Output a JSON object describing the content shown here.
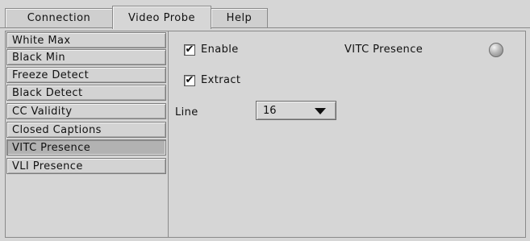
{
  "tabs": [
    {
      "label": "Connection",
      "active": false
    },
    {
      "label": "Video Probe",
      "active": true
    },
    {
      "label": "Help",
      "active": false
    }
  ],
  "sidebar": {
    "items": [
      {
        "label": "White Max"
      },
      {
        "label": "Black Min"
      },
      {
        "label": "Freeze Detect"
      },
      {
        "label": "Black Detect"
      },
      {
        "label": "CC Validity"
      },
      {
        "label": "Closed Captions"
      },
      {
        "label": "VITC Presence",
        "selected": true
      },
      {
        "label": "VLI Presence"
      }
    ]
  },
  "content": {
    "enable": {
      "label": "Enable",
      "checked": true,
      "mark": "✔"
    },
    "extract": {
      "label": "Extract",
      "checked": true,
      "mark": "✔"
    },
    "line": {
      "label": "Line",
      "value": "16"
    },
    "status": {
      "label": "VITC Presence",
      "led_color": "#a9a9a9"
    }
  }
}
